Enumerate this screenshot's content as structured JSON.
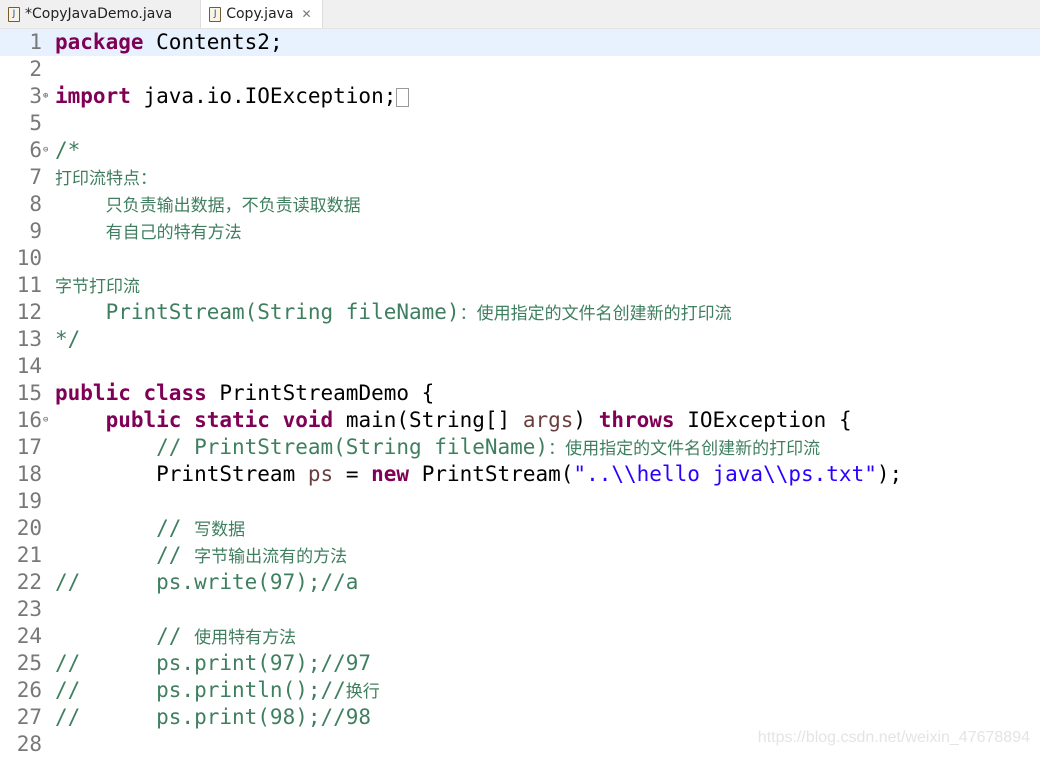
{
  "tabs": [
    {
      "label": "*CopyJavaDemo.java",
      "active": false
    },
    {
      "label": "Copy.java",
      "active": true
    }
  ],
  "colors": {
    "keyword": "#7f0055",
    "comment": "#3f7f5f",
    "string": "#2a00ff",
    "variable": "#6a3e3e"
  },
  "lines": [
    {
      "n": "1",
      "fold": "",
      "seg": [
        [
          "package",
          "k"
        ],
        [
          " Contents2;",
          ""
        ]
      ]
    },
    {
      "n": "2",
      "fold": "",
      "seg": []
    },
    {
      "n": "3",
      "fold": "⊕",
      "seg": [
        [
          "import",
          "k"
        ],
        [
          " java.io.IOException;",
          ""
        ]
      ],
      "box": true
    },
    {
      "n": "5",
      "fold": "",
      "seg": []
    },
    {
      "n": "6",
      "fold": "⊖",
      "seg": [
        [
          "/*",
          "c"
        ]
      ]
    },
    {
      "n": "7",
      "fold": "",
      "seg": [
        [
          "打印流特点：",
          "c cn"
        ]
      ]
    },
    {
      "n": "8",
      "fold": "",
      "seg": [
        [
          "    ",
          "c"
        ],
        [
          "只负责输出数据，不负责读取数据",
          "c cn"
        ]
      ]
    },
    {
      "n": "9",
      "fold": "",
      "seg": [
        [
          "    ",
          "c"
        ],
        [
          "有自己的特有方法",
          "c cn"
        ]
      ]
    },
    {
      "n": "10",
      "fold": "",
      "seg": []
    },
    {
      "n": "11",
      "fold": "",
      "seg": [
        [
          "字节打印流",
          "c cn"
        ]
      ]
    },
    {
      "n": "12",
      "fold": "",
      "seg": [
        [
          "    PrintStream(String fileName)",
          "c"
        ],
        [
          "：使用指定的文件名创建新的打印流",
          "c cn"
        ]
      ]
    },
    {
      "n": "13",
      "fold": "",
      "seg": [
        [
          "*/",
          "c"
        ]
      ]
    },
    {
      "n": "14",
      "fold": "",
      "seg": []
    },
    {
      "n": "15",
      "fold": "",
      "seg": [
        [
          "public",
          "k"
        ],
        [
          " ",
          ""
        ],
        [
          "class",
          "k"
        ],
        [
          " PrintStreamDemo {",
          ""
        ]
      ]
    },
    {
      "n": "16",
      "fold": "⊖",
      "seg": [
        [
          "    ",
          ""
        ],
        [
          "public",
          "k"
        ],
        [
          " ",
          ""
        ],
        [
          "static",
          "k"
        ],
        [
          " ",
          ""
        ],
        [
          "void",
          "k"
        ],
        [
          " main(String[] ",
          ""
        ],
        [
          "args",
          "v"
        ],
        [
          ") ",
          ""
        ],
        [
          "throws",
          "k"
        ],
        [
          " IOException {",
          ""
        ]
      ]
    },
    {
      "n": "17",
      "fold": "",
      "seg": [
        [
          "        // PrintStream(String fileName)",
          "c"
        ],
        [
          "：使用指定的文件名创建新的打印流",
          "c cn"
        ]
      ]
    },
    {
      "n": "18",
      "fold": "",
      "seg": [
        [
          "        PrintStream ",
          ""
        ],
        [
          "ps",
          "v"
        ],
        [
          " = ",
          ""
        ],
        [
          "new",
          "k"
        ],
        [
          " PrintStream(",
          ""
        ],
        [
          "\"..\\\\hello java\\\\ps.txt\"",
          "s"
        ],
        [
          ");",
          ""
        ]
      ]
    },
    {
      "n": "19",
      "fold": "",
      "seg": []
    },
    {
      "n": "20",
      "fold": "",
      "seg": [
        [
          "        // ",
          "c"
        ],
        [
          "写数据",
          "c cn"
        ]
      ]
    },
    {
      "n": "21",
      "fold": "",
      "seg": [
        [
          "        // ",
          "c"
        ],
        [
          "字节输出流有的方法",
          "c cn"
        ]
      ]
    },
    {
      "n": "22",
      "fold": "",
      "seg": [
        [
          "//      ps.write(97);//a",
          "c"
        ]
      ]
    },
    {
      "n": "23",
      "fold": "",
      "seg": []
    },
    {
      "n": "24",
      "fold": "",
      "seg": [
        [
          "        // ",
          "c"
        ],
        [
          "使用特有方法",
          "c cn"
        ]
      ]
    },
    {
      "n": "25",
      "fold": "",
      "seg": [
        [
          "//      ps.print(97);//97",
          "c"
        ]
      ]
    },
    {
      "n": "26",
      "fold": "",
      "seg": [
        [
          "//      ps.println();//",
          "c"
        ],
        [
          "换行",
          "c cn"
        ]
      ]
    },
    {
      "n": "27",
      "fold": "",
      "seg": [
        [
          "//      ps.print(98);//98",
          "c"
        ]
      ]
    },
    {
      "n": "28",
      "fold": "",
      "seg": []
    }
  ],
  "watermark": "https://blog.csdn.net/weixin_47678894"
}
